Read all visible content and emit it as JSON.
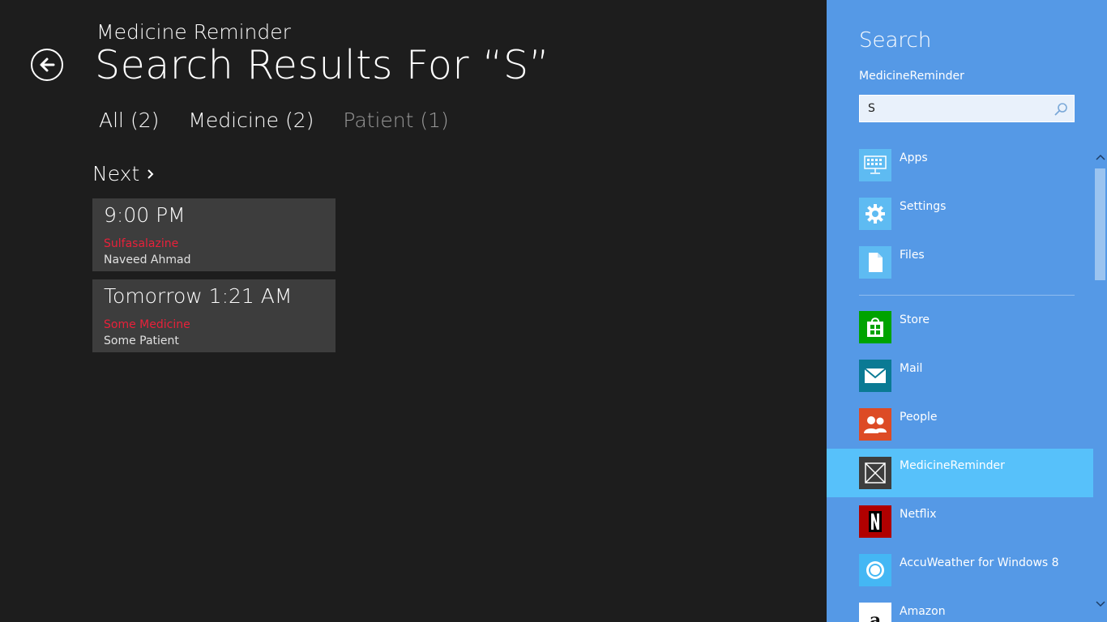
{
  "app": {
    "name": "Medicine Reminder",
    "page_title": "Search Results For  “S”"
  },
  "filters": [
    {
      "label": "All (2)"
    },
    {
      "label": "Medicine (2)"
    },
    {
      "label": "Patient (1)"
    }
  ],
  "next_label": "Next",
  "results": [
    {
      "time": "9:00 PM",
      "medicine": "Sulfasalazine",
      "patient": "Naveed Ahmad"
    },
    {
      "time": "Tomorrow 1:21 AM",
      "medicine": "Some Medicine",
      "patient": "Some Patient"
    }
  ],
  "search_pane": {
    "title": "Search",
    "scope": "MedicineReminder",
    "query": "S",
    "system_items": [
      {
        "label": "Apps",
        "icon": "apps-icon",
        "color": "#5ebbf2"
      },
      {
        "label": "Settings",
        "icon": "gear-icon",
        "color": "#5ebbf2"
      },
      {
        "label": "Files",
        "icon": "file-icon",
        "color": "#5ebbf2"
      }
    ],
    "app_items": [
      {
        "label": "Store",
        "icon": "store-icon",
        "color": "#00a300"
      },
      {
        "label": "Mail",
        "icon": "mail-icon",
        "color": "#0a7a94"
      },
      {
        "label": "People",
        "icon": "people-icon",
        "color": "#dd4b25"
      },
      {
        "label": "MedicineReminder",
        "icon": "app-placeholder-icon",
        "color": "#3d3d3d"
      },
      {
        "label": "Netflix",
        "icon": "netflix-icon",
        "color": "#b00000"
      },
      {
        "label": "AccuWeather for Windows 8",
        "icon": "weather-icon",
        "color": "#44b7f4"
      },
      {
        "label": "Amazon",
        "icon": "amazon-icon",
        "color": "#ffffff"
      }
    ]
  },
  "colors": {
    "background": "#1d1d1d",
    "card": "#3d3d3d",
    "medicine_text": "#e8213a",
    "pane": "#5599e6",
    "selected": "#57c1fa"
  }
}
